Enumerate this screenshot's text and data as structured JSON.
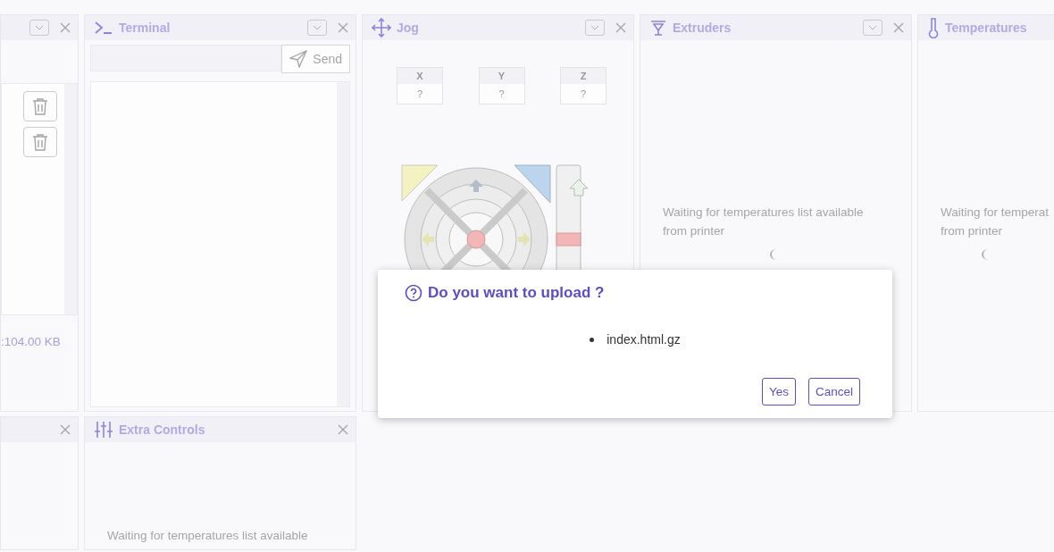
{
  "top_row": [
    {
      "kind": "files",
      "collapsible": true,
      "closable": true,
      "file_rows": [
        {
          "deletable": true
        },
        {
          "deletable": true
        }
      ],
      "size_text": ":104.00 KB"
    },
    {
      "kind": "terminal",
      "title": "Terminal",
      "collapsible": true,
      "closable": true,
      "send_label": "Send"
    },
    {
      "kind": "jog",
      "title": "Jog",
      "collapsible": true,
      "closable": true,
      "positions": [
        {
          "axis": "X",
          "value": "?"
        },
        {
          "axis": "Y",
          "value": "?"
        },
        {
          "axis": "Z",
          "value": "?"
        }
      ]
    },
    {
      "kind": "extruders",
      "title": "Extruders",
      "collapsible": true,
      "closable": true,
      "message_lines": [
        "Waiting for temperatures list available",
        "from printer"
      ]
    },
    {
      "kind": "temperatures",
      "title": "Temperatures",
      "collapsible": false,
      "closable": false,
      "message_lines": [
        "Waiting for temperat",
        "from printer"
      ]
    }
  ],
  "bottom_row": [
    {
      "kind": "empty",
      "collapsible": false,
      "closable": true
    },
    {
      "kind": "extra",
      "title": "Extra Controls",
      "collapsible": false,
      "closable": true,
      "message_lines": [
        "Waiting for temperatures list available"
      ]
    }
  ],
  "dialog": {
    "title": "Do you want to upload ?",
    "files": [
      "index.html.gz"
    ],
    "buttons": [
      "Yes",
      "Cancel"
    ]
  }
}
